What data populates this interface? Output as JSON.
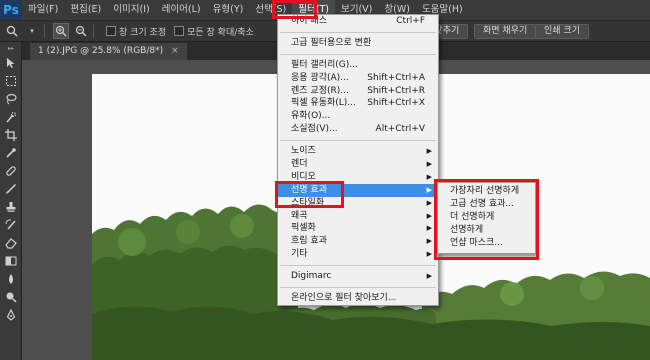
{
  "menubar": {
    "logo": "Ps",
    "items": [
      "파일(F)",
      "편집(E)",
      "이미지(I)",
      "레이어(L)",
      "유형(Y)",
      "선택(S)",
      "필터(T)",
      "보기(V)",
      "창(W)",
      "도움말(H)"
    ]
  },
  "options": {
    "resize_label": "창 크기 조정",
    "zoom_all_label": "모든 창 확대/축소",
    "fit_label": "화면 맞추기",
    "fill_label": "화면 채우기",
    "print_label": "인쇄 크기"
  },
  "document": {
    "tab_title": "1 (2).JPG @ 25.8% (RGB/8*)",
    "close": "×"
  },
  "filter_menu": {
    "last_filter": "하이 패스",
    "last_filter_shortcut": "Ctrl+F",
    "convert_smart": "고급 필터용으로 변환",
    "gallery": "필터 갤러리(G)...",
    "adaptive_wide": "응용 광각(A)...",
    "adaptive_wide_shortcut": "Shift+Ctrl+A",
    "lens_correction": "렌즈 교정(R)...",
    "lens_correction_shortcut": "Shift+Ctrl+R",
    "liquify": "픽셀 유동화(L)...",
    "liquify_shortcut": "Shift+Ctrl+X",
    "oil_paint": "유화(O)...",
    "vanishing_point": "소실점(V)...",
    "vanishing_point_shortcut": "Alt+Ctrl+V",
    "noise": "노이즈",
    "render": "렌더",
    "video": "비디오",
    "sharpen": "선명 효과",
    "stylize": "스타일화",
    "distort": "왜곡",
    "pixelate": "픽셀화",
    "blur": "흐림 효과",
    "other": "기타",
    "digimarc": "Digimarc",
    "browse_online": "온라인으로 필터 찾아보기..."
  },
  "sharpen_submenu": {
    "items": [
      "가장자리 선명하게",
      "고급 선명 효과...",
      "더 선명하게",
      "선명하게",
      "언샵 마스크..."
    ]
  },
  "colors": {
    "highlight": "#3d8ee5",
    "annotation_red": "#e0141e"
  }
}
